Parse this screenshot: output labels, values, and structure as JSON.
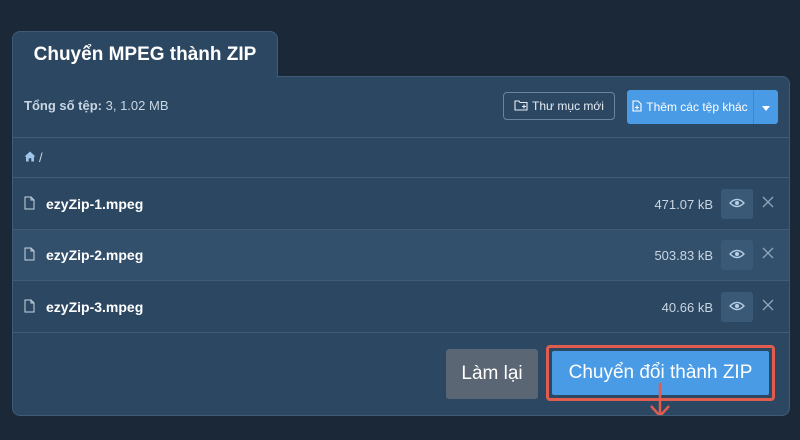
{
  "header": {
    "title": "Chuyển MPEG thành ZIP"
  },
  "toolbar": {
    "summary_label": "Tổng số tệp:",
    "summary_value": "3, 1.02 MB",
    "new_folder_label": "Thư mục mới",
    "add_files_label": "Thêm các tệp khác"
  },
  "breadcrumb": {
    "separator": "/"
  },
  "files": [
    {
      "name": "ezyZip-1.mpeg",
      "size": "471.07 kB"
    },
    {
      "name": "ezyZip-2.mpeg",
      "size": "503.83 kB"
    },
    {
      "name": "ezyZip-3.mpeg",
      "size": "40.66 kB"
    }
  ],
  "actions": {
    "reset_label": "Làm lại",
    "convert_label": "Chuyển đổi thành ZIP"
  },
  "icons": {
    "home": "home-icon",
    "folder_add": "folder-add-icon",
    "file_add": "file-add-icon",
    "file": "file-icon",
    "eye": "eye-icon",
    "close": "close-icon",
    "caret": "caret-down-icon",
    "arrow": "arrow-down-icon"
  },
  "colors": {
    "background": "#1a2838",
    "panel": "#2c4761",
    "accent": "#4a9be6",
    "reset": "#5a6673",
    "highlight": "#e05c4e"
  }
}
